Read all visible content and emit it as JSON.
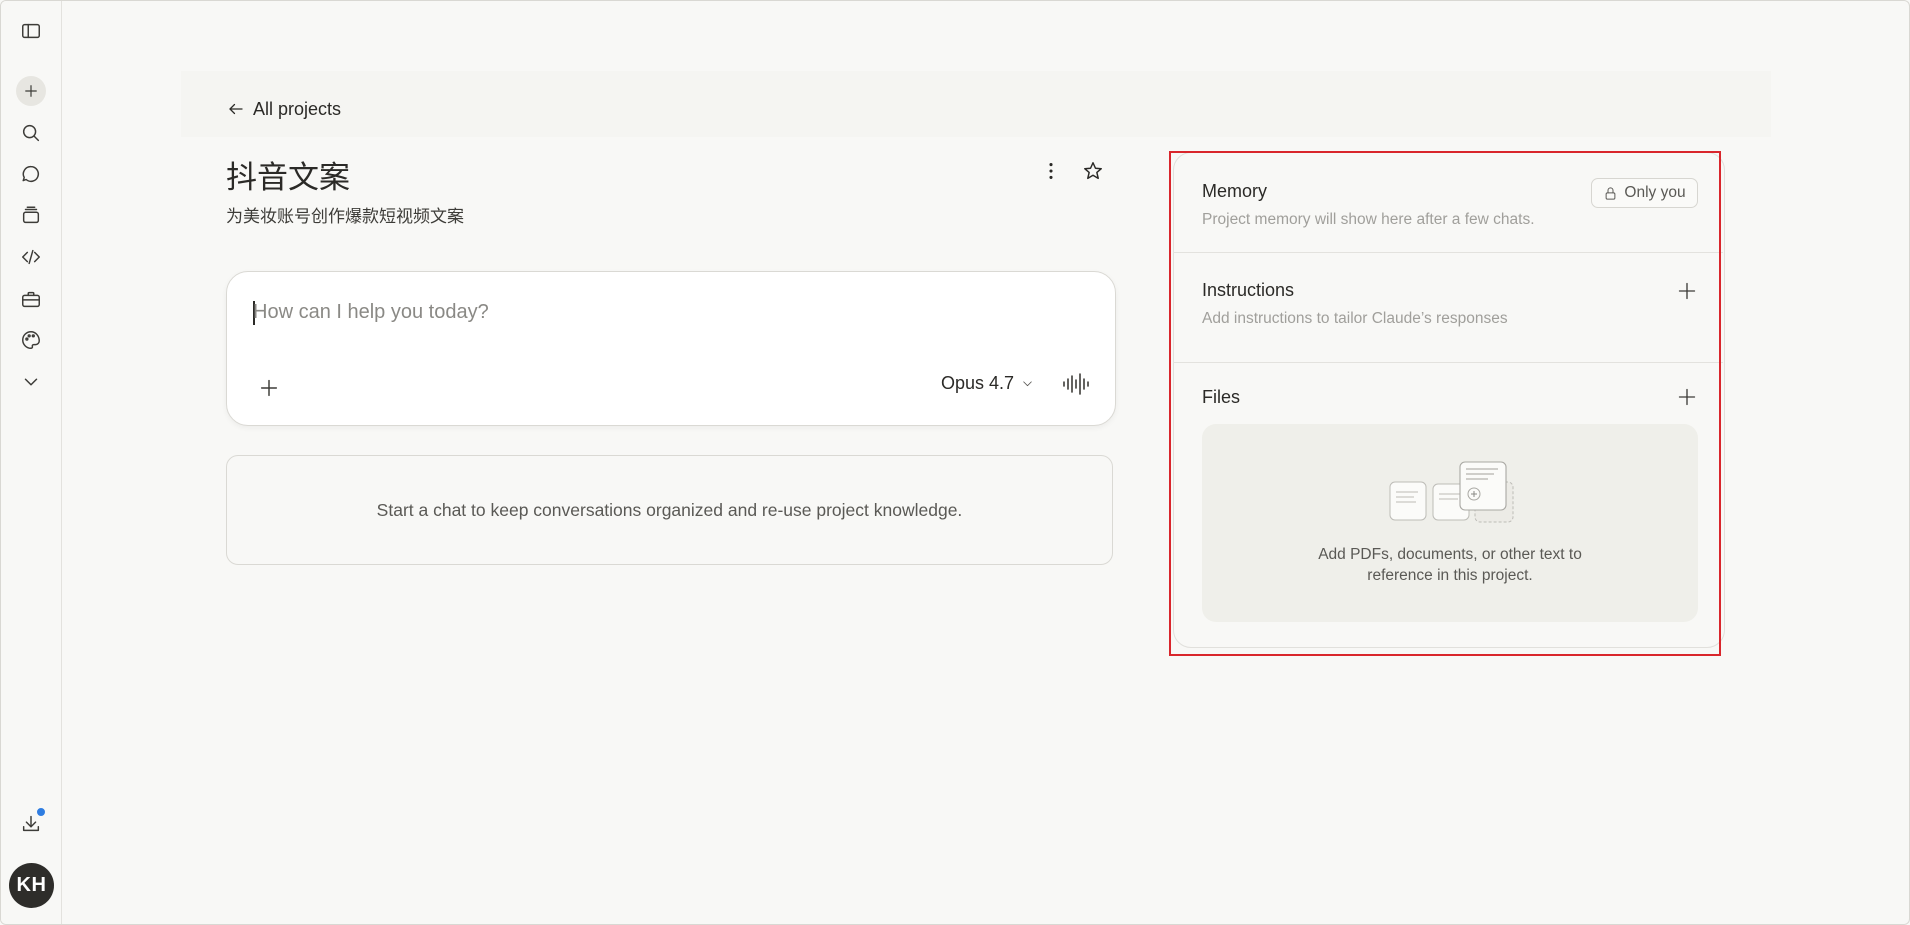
{
  "sidebar": {
    "items": [
      {
        "name": "sidebar-toggle-icon"
      },
      {
        "name": "new-chat-icon"
      },
      {
        "name": "search-icon"
      },
      {
        "name": "chats-icon"
      },
      {
        "name": "projects-icon"
      },
      {
        "name": "code-icon"
      },
      {
        "name": "toolbox-icon"
      },
      {
        "name": "palette-icon"
      },
      {
        "name": "chevron-down-icon"
      }
    ],
    "download_icon": "download-icon",
    "avatar_initials": "KH"
  },
  "header": {
    "back_label": "All projects"
  },
  "project": {
    "title": "抖音文案",
    "description": "为美妆账号创作爆款短视频文案"
  },
  "composer": {
    "placeholder": "How can I help you today?",
    "model": "Opus 4.7"
  },
  "empty_state": {
    "text": "Start a chat to keep conversations organized and re-use project knowledge."
  },
  "panel": {
    "memory": {
      "title": "Memory",
      "badge": "Only you",
      "description": "Project memory will show here after a few chats."
    },
    "instructions": {
      "title": "Instructions",
      "description": "Add instructions to tailor Claude’s responses"
    },
    "files": {
      "title": "Files",
      "line1": "Add PDFs, documents, or other text to",
      "line2": "reference in this project."
    }
  },
  "colors": {
    "background": "#f8f8f6",
    "highlight": "#d9262c",
    "notification": "#2f7de1",
    "avatar": "#2e2d2a"
  }
}
